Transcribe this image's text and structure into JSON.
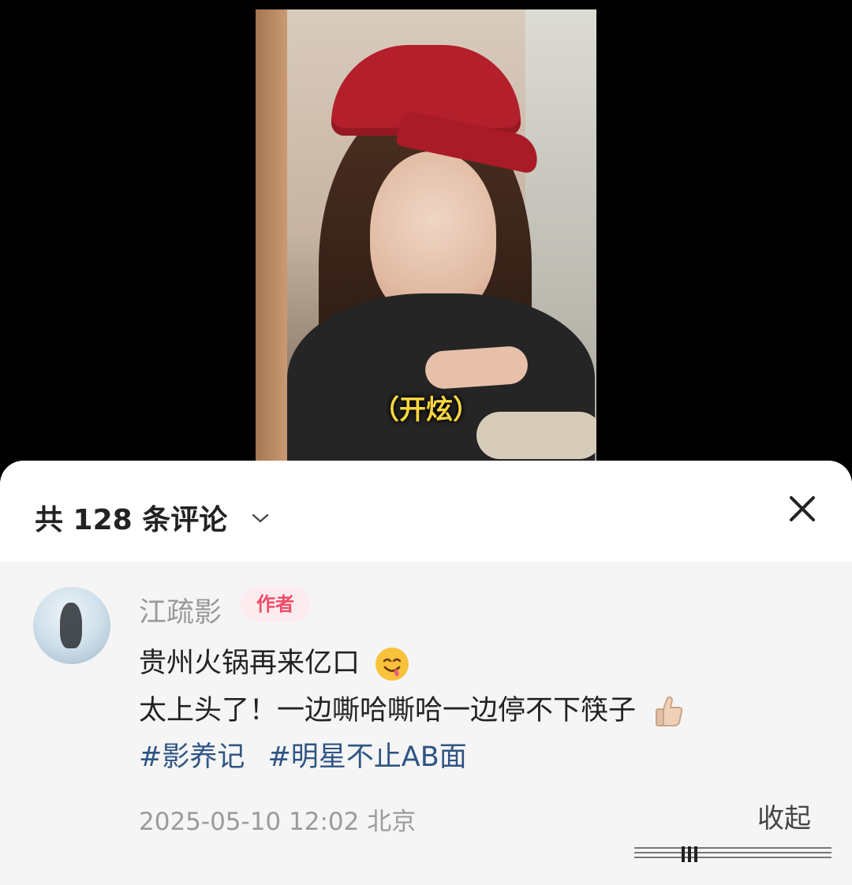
{
  "video": {
    "subtitle": "（开炫）"
  },
  "comments": {
    "header_title": "共 128 条评论",
    "dropdown_icon": "chevron-down-icon",
    "close_icon": "close-icon",
    "items": [
      {
        "author": "江疏影",
        "badge": "作者",
        "lines": [
          "贵州火锅再来亿口",
          "太上头了！一边嘶哈嘶哈一边停不下筷子"
        ],
        "emojis": [
          "yum-emoji",
          "thumbs-up-emoji"
        ],
        "hashtags": [
          "#影养记",
          "#明星不止AB面"
        ],
        "timestamp": "2025-05-10 12:02",
        "location": "北京",
        "collapse_label": "收起"
      }
    ]
  },
  "colors": {
    "background": "#000000",
    "sheet": "#f6f6f6",
    "header": "#ffffff",
    "badge_bg": "#fdecef",
    "badge_text": "#f04b67",
    "hashtag": "#2f5584"
  }
}
